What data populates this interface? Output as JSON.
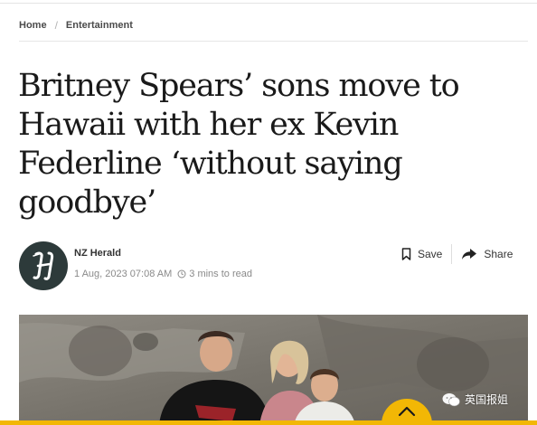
{
  "breadcrumb": {
    "home": "Home",
    "section": "Entertainment",
    "separator": "/"
  },
  "article": {
    "headline_lines": [
      "Britney Spears’ sons move to",
      "Hawaii with her ex Kevin",
      "Federline ‘without saying",
      "goodbye’"
    ],
    "author": "NZ Herald",
    "date": "1 Aug, 2023 07:08 AM",
    "read_time": "3 mins to read"
  },
  "actions": {
    "save": "Save",
    "share": "Share"
  },
  "watermark": {
    "text": "英国报姐"
  },
  "colors": {
    "accent": "#f2b705",
    "avatar_bg": "#2d3a3a",
    "text": "#222222",
    "muted": "#8a8a8a"
  },
  "icons": {
    "avatar": "herald-logo-icon",
    "save": "bookmark-icon",
    "share": "share-arrow-icon",
    "clock": "clock-icon",
    "back_to_top": "chevron-up-icon",
    "watermark": "wechat-icon"
  }
}
